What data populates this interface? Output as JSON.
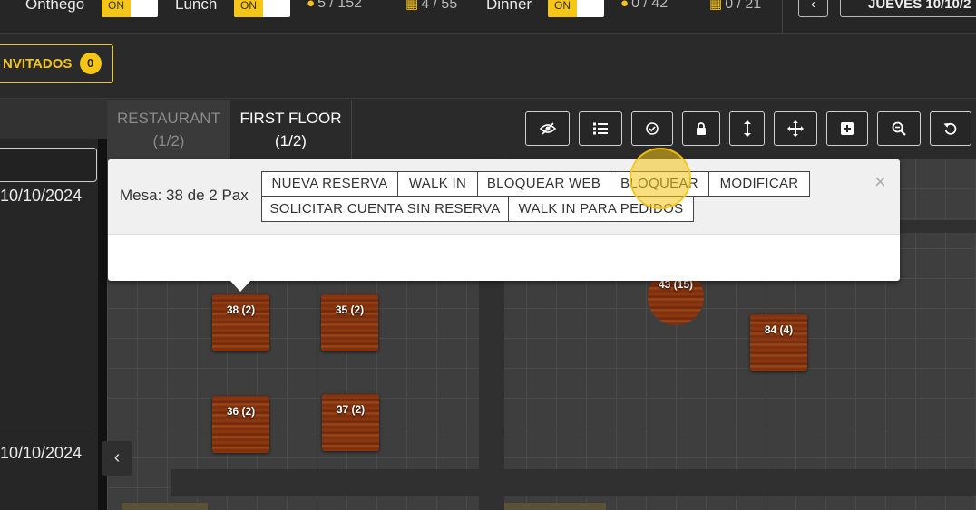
{
  "topbar": {
    "label_1": "Onthego",
    "toggle_1": "ON",
    "label_2": "Lunch",
    "toggle_2": "ON",
    "stat_1": "5 / 152",
    "stat_2": "4 / 55",
    "label_3": "Dinner",
    "toggle_3": "ON",
    "stat_3": "0 / 42",
    "stat_4": "0 / 21",
    "prev_label": "‹",
    "date_label": "JUEVES 10/10/2"
  },
  "invitados": {
    "label": "NVITADOS",
    "count": "0"
  },
  "left": {
    "date_1": "10/10/2024",
    "date_2": "10/10/2024",
    "collapse": "‹"
  },
  "tabs": [
    {
      "name": "RESTAURANT",
      "page": "(1/2)"
    },
    {
      "name": "FIRST FLOOR",
      "page": "(1/2)"
    }
  ],
  "toolbar": [
    "eye-slash-icon",
    "list-icon",
    "check-circle-icon",
    "lock-icon",
    "vertical-resize-icon",
    "move-icon",
    "plus-square-icon",
    "zoom-out-icon",
    "undo-icon"
  ],
  "popup": {
    "mesa": "Mesa: 38 de 2 Pax",
    "buttons_row1": [
      "NUEVA RESERVA",
      "WALK IN",
      "BLOQUEAR WEB",
      "BLOQUEAR",
      "MODIFICAR"
    ],
    "buttons_row2": [
      "SOLICITAR CUENTA SIN RESERVA",
      "WALK IN PARA PEDIDOS"
    ],
    "close": "×"
  },
  "tables": [
    {
      "label": "38 (2)"
    },
    {
      "label": "35 (2)"
    },
    {
      "label": "36 (2)"
    },
    {
      "label": "37 (2)"
    },
    {
      "label": "43 (15)"
    },
    {
      "label": "84 (4)"
    }
  ],
  "colors": {
    "accent": "#f5c518",
    "background": "#2a2a2a",
    "wood": "#7a2e0c"
  }
}
